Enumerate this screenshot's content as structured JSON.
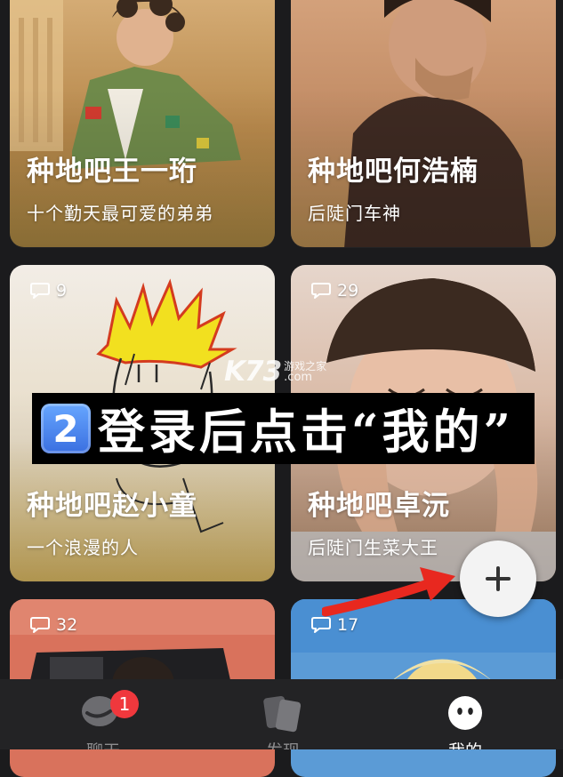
{
  "cards": [
    {
      "title": "种地吧王一珩",
      "subtitle": "十个勤天最可爱的弟弟",
      "comments": ""
    },
    {
      "title": "种地吧何浩楠",
      "subtitle": "后陡门车神",
      "comments": ""
    },
    {
      "title": "种地吧赵小童",
      "subtitle": "一个浪漫的人",
      "comments": "9"
    },
    {
      "title": "种地吧卓沅",
      "subtitle": "后陡门生菜大王",
      "comments": "29"
    },
    {
      "title": "",
      "subtitle": "",
      "comments": "32"
    },
    {
      "title": "",
      "subtitle": "",
      "comments": "17"
    }
  ],
  "banner": {
    "number": "2",
    "text": "登录后点击“我的”"
  },
  "watermark": {
    "logo": "K73",
    "site_name": "游戏之家",
    "domain": ".com"
  },
  "tabs": [
    {
      "label": "聊天",
      "badge": "1",
      "icon": "chat-icon"
    },
    {
      "label": "发现",
      "icon": "discover-icon"
    },
    {
      "label": "我的",
      "icon": "profile-icon"
    }
  ],
  "fab": {
    "icon": "plus-icon"
  },
  "colors": {
    "accent_red": "#f0383d",
    "annotation_red": "#e8281f",
    "tab_bar": "#232325"
  }
}
